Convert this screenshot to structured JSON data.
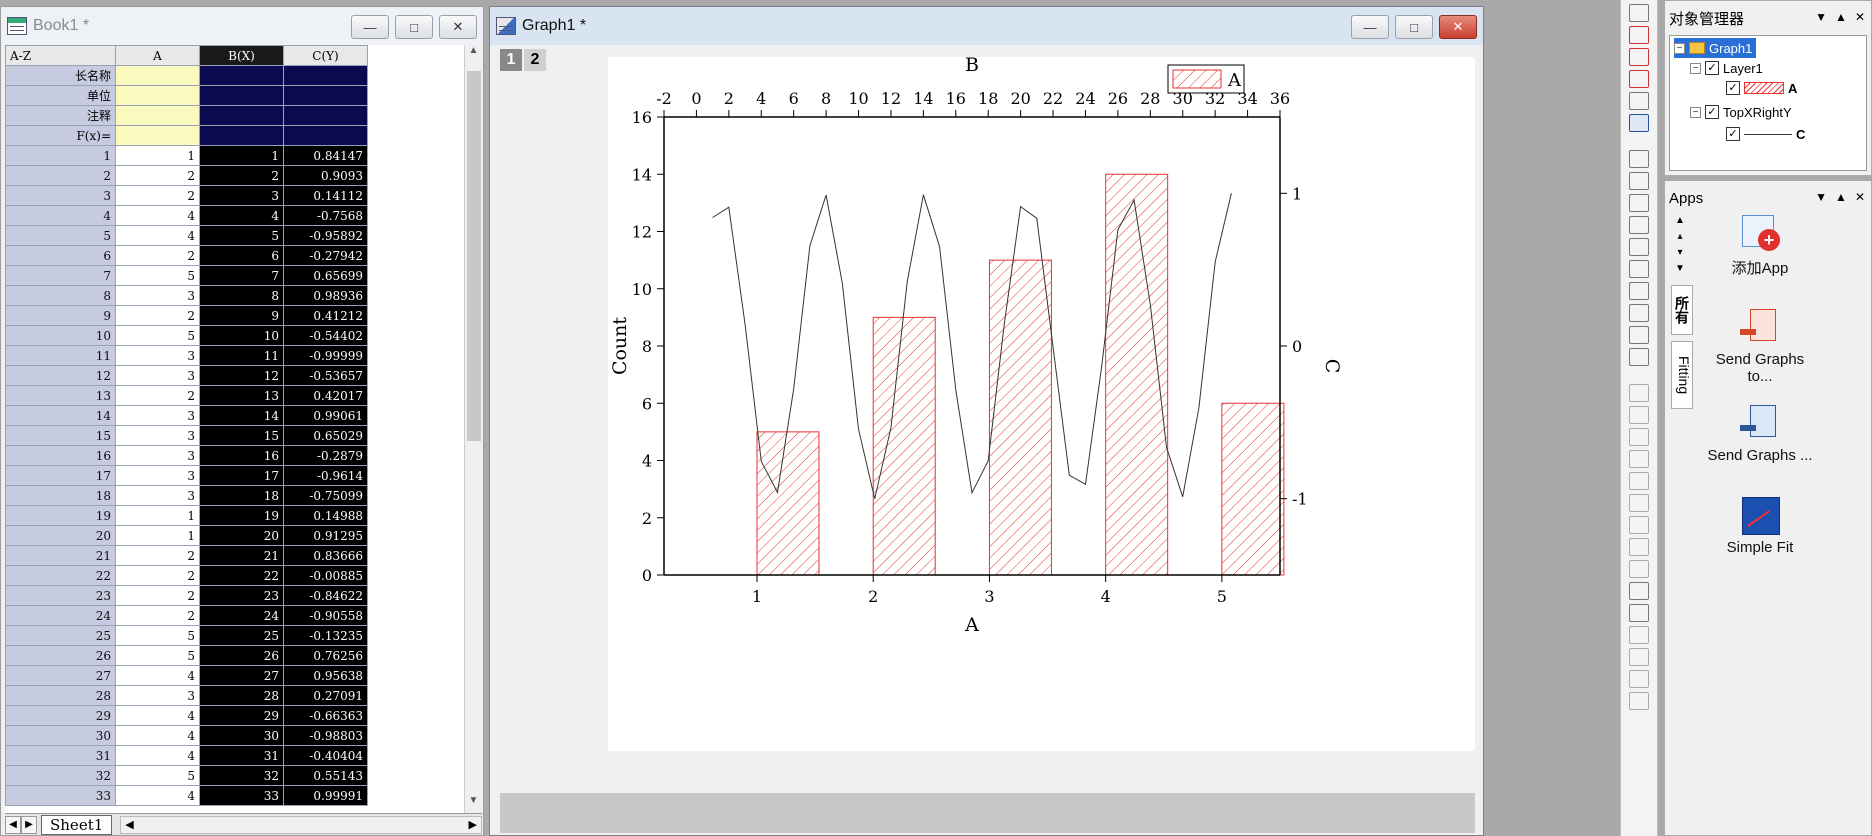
{
  "book": {
    "title": "Book1 *",
    "corner_label": "A-Z",
    "columns": [
      {
        "header": "A"
      },
      {
        "header": "B(X)"
      },
      {
        "header": "C(Y)"
      }
    ],
    "meta_rows": [
      "长名称",
      "单位",
      "注释",
      "F(x)="
    ],
    "rows": [
      [
        "1",
        "1",
        "1",
        "0.84147"
      ],
      [
        "2",
        "2",
        "2",
        "0.9093"
      ],
      [
        "3",
        "2",
        "3",
        "0.14112"
      ],
      [
        "4",
        "4",
        "4",
        "-0.7568"
      ],
      [
        "5",
        "4",
        "5",
        "-0.95892"
      ],
      [
        "6",
        "2",
        "6",
        "-0.27942"
      ],
      [
        "7",
        "5",
        "7",
        "0.65699"
      ],
      [
        "8",
        "3",
        "8",
        "0.98936"
      ],
      [
        "9",
        "2",
        "9",
        "0.41212"
      ],
      [
        "10",
        "5",
        "10",
        "-0.54402"
      ],
      [
        "11",
        "3",
        "11",
        "-0.99999"
      ],
      [
        "12",
        "3",
        "12",
        "-0.53657"
      ],
      [
        "13",
        "2",
        "13",
        "0.42017"
      ],
      [
        "14",
        "3",
        "14",
        "0.99061"
      ],
      [
        "15",
        "3",
        "15",
        "0.65029"
      ],
      [
        "16",
        "3",
        "16",
        "-0.2879"
      ],
      [
        "17",
        "3",
        "17",
        "-0.9614"
      ],
      [
        "18",
        "3",
        "18",
        "-0.75099"
      ],
      [
        "19",
        "1",
        "19",
        "0.14988"
      ],
      [
        "20",
        "1",
        "20",
        "0.91295"
      ],
      [
        "21",
        "2",
        "21",
        "0.83666"
      ],
      [
        "22",
        "2",
        "22",
        "-0.00885"
      ],
      [
        "23",
        "2",
        "23",
        "-0.84622"
      ],
      [
        "24",
        "2",
        "24",
        "-0.90558"
      ],
      [
        "25",
        "5",
        "25",
        "-0.13235"
      ],
      [
        "26",
        "5",
        "26",
        "0.76256"
      ],
      [
        "27",
        "4",
        "27",
        "0.95638"
      ],
      [
        "28",
        "3",
        "28",
        "0.27091"
      ],
      [
        "29",
        "4",
        "29",
        "-0.66363"
      ],
      [
        "30",
        "4",
        "30",
        "-0.98803"
      ],
      [
        "31",
        "4",
        "31",
        "-0.40404"
      ],
      [
        "32",
        "5",
        "32",
        "0.55143"
      ],
      [
        "33",
        "4",
        "33",
        "0.99991"
      ]
    ],
    "sheet_tab": "Sheet1"
  },
  "graph": {
    "title": "Graph1 *",
    "layer_tabs": [
      "1",
      "2"
    ]
  },
  "chart_data": {
    "type": "bar",
    "title": "",
    "bars": {
      "name": "A",
      "categories": [
        1,
        2,
        3,
        4,
        5
      ],
      "values": [
        5,
        9,
        11,
        14,
        6
      ],
      "color": "#e8312f",
      "pattern": "diagonal-hatch"
    },
    "line": {
      "name": "C",
      "x": [
        1,
        2,
        3,
        4,
        5,
        6,
        7,
        8,
        9,
        10,
        11,
        12,
        13,
        14,
        15,
        16,
        17,
        18,
        19,
        20,
        21,
        22,
        23,
        24,
        25,
        26,
        27,
        28,
        29,
        30,
        31,
        32,
        33
      ],
      "y": [
        0.84147,
        0.9093,
        0.14112,
        -0.7568,
        -0.95892,
        -0.27942,
        0.65699,
        0.98936,
        0.41212,
        -0.54402,
        -0.99999,
        -0.53657,
        0.42017,
        0.99061,
        0.65029,
        -0.2879,
        -0.9614,
        -0.75099,
        0.14988,
        0.91295,
        0.83666,
        -0.00885,
        -0.84622,
        -0.90558,
        -0.13235,
        0.76256,
        0.95638,
        0.27091,
        -0.66363,
        -0.98803,
        -0.40404,
        0.55143,
        0.99991
      ],
      "color": "#333333"
    },
    "axes": {
      "bottom": {
        "label": "A",
        "ticks": [
          "1",
          "2",
          "3",
          "4",
          "5"
        ],
        "range": [
          0.2,
          5.5
        ]
      },
      "left": {
        "label": "Count",
        "ticks": [
          "0",
          "2",
          "4",
          "6",
          "8",
          "10",
          "12",
          "14",
          "16"
        ],
        "range": [
          0,
          16
        ]
      },
      "top": {
        "label": "B",
        "ticks": [
          "-2",
          "0",
          "2",
          "4",
          "6",
          "8",
          "10",
          "12",
          "14",
          "16",
          "18",
          "20",
          "22",
          "24",
          "26",
          "28",
          "30",
          "32",
          "34",
          "36"
        ],
        "range": [
          -2,
          36
        ]
      },
      "right": {
        "label": "C",
        "ticks": [
          "1",
          "0",
          "-1"
        ],
        "range": [
          -1.5,
          1.5
        ]
      }
    },
    "legend": {
      "entries": [
        "A"
      ],
      "position": "top-right"
    },
    "grid": false
  },
  "object_manager": {
    "title": "对象管理器",
    "tree": [
      "Graph1",
      "Layer1",
      "A",
      "TopXRightY",
      "C"
    ]
  },
  "apps": {
    "title": "Apps",
    "side_tabs": [
      "所有",
      "Fitting"
    ],
    "items": [
      "添加App",
      "Send Graphs to...",
      "Send Graphs ...",
      "Simple Fit"
    ]
  }
}
